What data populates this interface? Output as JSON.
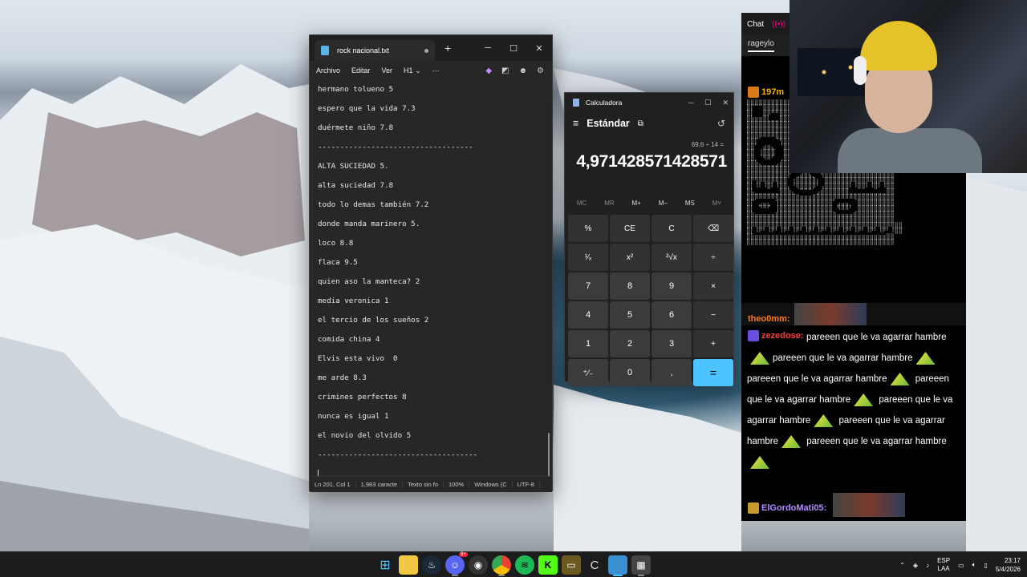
{
  "notepad": {
    "tab_title": "rock nacional.txt",
    "new_tab": "+",
    "menu": [
      "Archivo",
      "Editar",
      "Ver"
    ],
    "heading_menu": "H1",
    "lines": [
      "hermano tolueno 5",
      "espero que la vida 7.3",
      "duérmete niño 7.8",
      "-----------------------------------",
      "ALTA SUCIEDAD 5.",
      "alta suciedad 7.8",
      "todo lo demas también 7.2",
      "donde manda marinero 5.",
      "loco 8.8",
      "flaca 9.5",
      "quien aso la manteca? 2",
      "media veronica 1",
      "el tercio de los sueños 2",
      "comida china 4",
      "Elvis esta vivo  0",
      "me arde 8.3",
      "crimines perfectos 8",
      "nunca es igual 1",
      "el novio del olvido 5",
      "------------------------------------"
    ],
    "status": {
      "position": "Ln 201, Col 1",
      "chars": "1,983 caracte",
      "format": "Texto sin fo",
      "zoom": "100%",
      "line_ending": "Windows (C",
      "encoding": "UTF-8"
    }
  },
  "calculator": {
    "title": "Calculadora",
    "mode": "Estándar",
    "expression": "69,6 ÷ 14 =",
    "display": "4,971428571428571",
    "memory": [
      "MC",
      "MR",
      "M+",
      "M−",
      "MS",
      "M˅"
    ],
    "keys": [
      "%",
      "CE",
      "C",
      "⌫",
      "¹⁄ₓ",
      "x²",
      "²√x",
      "÷",
      "7",
      "8",
      "9",
      "×",
      "4",
      "5",
      "6",
      "−",
      "1",
      "2",
      "3",
      "+",
      "⁺⁄₋",
      "0",
      ",",
      "="
    ]
  },
  "chat": {
    "header": "Chat",
    "tab": "rageylo",
    "users": {
      "u1": "197m",
      "u2": "theo0mm:",
      "u3": "zezedose:",
      "u4": "ElGordoMati05:"
    },
    "message": "pareeen que le va agarrar hambre",
    "colors": {
      "u1": "#f4b400",
      "u2": "#ff7a1a",
      "u3": "#ff3b3b",
      "u4": "#b48cff"
    }
  },
  "taskbar": {
    "lang_top": "ESP",
    "lang_bottom": "LAA",
    "time": "23:17",
    "date": "5/4/2026",
    "discord_badge": "9+"
  }
}
